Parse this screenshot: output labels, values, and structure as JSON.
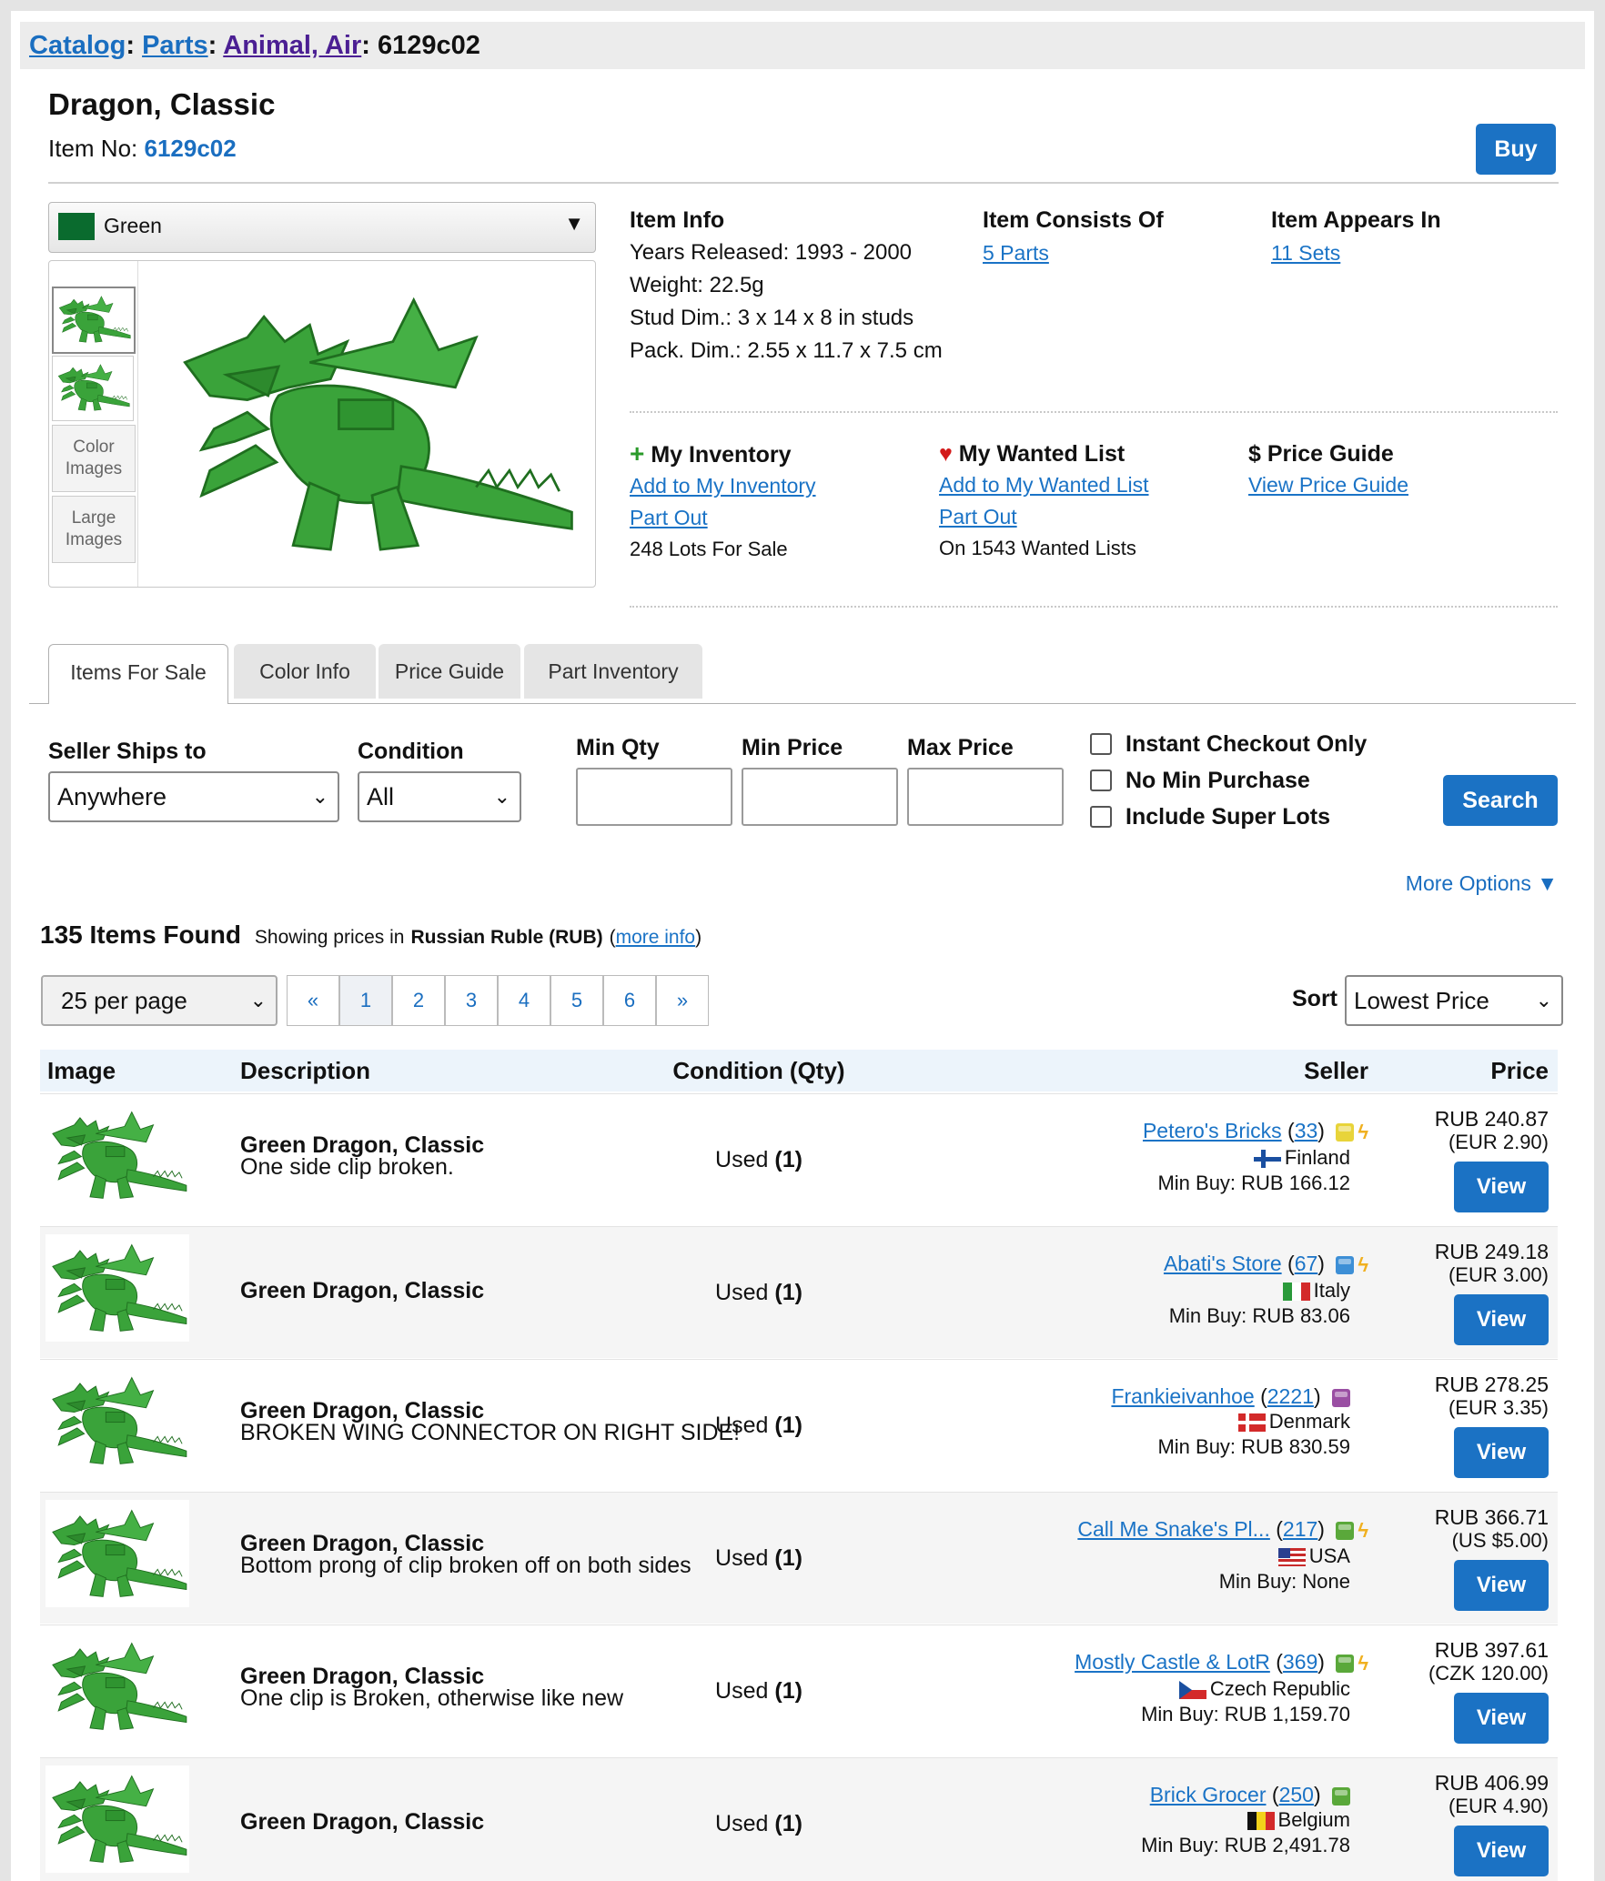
{
  "breadcrumb": {
    "catalog": "Catalog",
    "parts": "Parts",
    "category": "Animal, Air",
    "item_id": "6129c02"
  },
  "item": {
    "name": "Dragon, Classic",
    "item_no_label": "Item No:",
    "item_no": "6129c02",
    "buy_label": "Buy"
  },
  "color_select": {
    "value": "Green",
    "swatch": "#0a6b2e"
  },
  "thumbs": {
    "color_images": "Color Images",
    "large_images": "Large Images"
  },
  "item_info": {
    "title": "Item Info",
    "years": "Years Released: 1993 - 2000",
    "weight": "Weight: 22.5g",
    "stud": "Stud Dim.: 3 x 14 x 8 in studs",
    "pack": "Pack. Dim.: 2.55 x 11.7 x 7.5 cm"
  },
  "consists": {
    "title": "Item Consists Of",
    "link": "5 Parts"
  },
  "appears": {
    "title": "Item Appears In",
    "link": "11 Sets"
  },
  "inventory": {
    "icon": "plus-icon",
    "title": "My Inventory",
    "add": "Add to My Inventory",
    "partout": "Part Out",
    "lots": "248 Lots For Sale"
  },
  "wanted": {
    "icon": "heart-icon",
    "title": "My Wanted List",
    "add": "Add to My Wanted List",
    "partout": "Part Out",
    "count": "On 1543 Wanted Lists"
  },
  "priceguide": {
    "icon": "dollar-icon",
    "symbol": "$",
    "title": "Price Guide",
    "view": "View Price Guide"
  },
  "tabs": [
    "Items For Sale",
    "Color Info",
    "Price Guide",
    "Part Inventory"
  ],
  "filters": {
    "ships_label": "Seller Ships to",
    "ships_value": "Anywhere",
    "condition_label": "Condition",
    "condition_value": "All",
    "minqty_label": "Min Qty",
    "minprice_label": "Min Price",
    "maxprice_label": "Max Price",
    "instant": "Instant Checkout Only",
    "nomin": "No Min Purchase",
    "superlots": "Include Super Lots",
    "search_label": "Search",
    "more_options": "More Options ▼"
  },
  "results": {
    "count": "135 Items Found",
    "showing": "Showing prices in",
    "currency": "Russian Ruble (RUB)",
    "more_info": "more info",
    "per_page": "25 per page",
    "pages": [
      "«",
      "1",
      "2",
      "3",
      "4",
      "5",
      "6",
      "»"
    ],
    "sort_label": "Sort",
    "sort_value": "Lowest Price"
  },
  "table": {
    "headers": {
      "image": "Image",
      "description": "Description",
      "condition": "Condition (Qty)",
      "seller": "Seller",
      "price": "Price"
    },
    "view_label": "View",
    "rows": [
      {
        "title": "Green Dragon, Classic",
        "note": "One side clip broken.",
        "cond": "Used",
        "qty": "(1)",
        "seller": "Petero's Bricks",
        "feedback": "33",
        "cube": "#e8d43a",
        "bolt": true,
        "country": "Finland",
        "flag": "fi",
        "minbuy": "Min Buy: RUB 166.12",
        "price": "RUB 240.87",
        "orig": "(EUR 2.90)"
      },
      {
        "title": "Green Dragon, Classic",
        "note": "",
        "cond": "Used",
        "qty": "(1)",
        "seller": "Abati's Store",
        "feedback": "67",
        "cube": "#3d8fd6",
        "bolt": true,
        "country": "Italy",
        "flag": "it",
        "minbuy": "Min Buy: RUB 83.06",
        "price": "RUB 249.18",
        "orig": "(EUR 3.00)"
      },
      {
        "title": "Green Dragon, Classic",
        "note": "BROKEN WING CONNECTOR ON RIGHT SIDE!",
        "cond": "Used",
        "qty": "(1)",
        "seller": "Frankieivanhoe",
        "feedback": "2221",
        "cube": "#9a4fa3",
        "bolt": false,
        "country": "Denmark",
        "flag": "dk",
        "minbuy": "Min Buy: RUB 830.59",
        "price": "RUB 278.25",
        "orig": "(EUR 3.35)"
      },
      {
        "title": "Green Dragon, Classic",
        "note": "Bottom prong of clip broken off on both sides",
        "cond": "Used",
        "qty": "(1)",
        "seller": "Call Me Snake's Pl...",
        "feedback": "217",
        "cube": "#5aa83a",
        "bolt": true,
        "country": "USA",
        "flag": "us",
        "minbuy": "Min Buy: None",
        "price": "RUB 366.71",
        "orig": "(US $5.00)"
      },
      {
        "title": "Green Dragon, Classic",
        "note": "One clip is Broken, otherwise like new",
        "cond": "Used",
        "qty": "(1)",
        "seller": "Mostly Castle & LotR",
        "feedback": "369",
        "cube": "#5aa83a",
        "bolt": true,
        "country": "Czech Republic",
        "flag": "cz",
        "minbuy": "Min Buy: RUB 1,159.70",
        "price": "RUB 397.61",
        "orig": "(CZK 120.00)"
      },
      {
        "title": "Green Dragon, Classic",
        "note": "",
        "cond": "Used",
        "qty": "(1)",
        "seller": "Brick Grocer",
        "feedback": "250",
        "cube": "#5aa83a",
        "bolt": false,
        "country": "Belgium",
        "flag": "be",
        "minbuy": "Min Buy: RUB 2,491.78",
        "price": "RUB 406.99",
        "orig": "(EUR 4.90)"
      }
    ]
  }
}
